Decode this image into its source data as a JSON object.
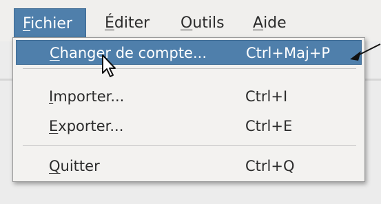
{
  "menubar": {
    "file": {
      "pre": "",
      "key": "F",
      "post": "ichier"
    },
    "edit": {
      "pre": "",
      "key": "É",
      "post": "diter"
    },
    "tools": {
      "pre": "",
      "key": "O",
      "post": "utils"
    },
    "help": {
      "pre": "",
      "key": "A",
      "post": "ide"
    }
  },
  "file_menu": {
    "items": [
      {
        "pre": "",
        "key": "C",
        "post": "hanger de compte...",
        "shortcut": "Ctrl+Maj+P"
      },
      {
        "pre": "",
        "key": "I",
        "post": "mporter...",
        "shortcut": "Ctrl+I"
      },
      {
        "pre": "",
        "key": "E",
        "post": "xporter...",
        "shortcut": "Ctrl+E"
      },
      {
        "pre": "",
        "key": "Q",
        "post": "uitter",
        "shortcut": "Ctrl+Q"
      }
    ]
  },
  "colors": {
    "highlight": "#4f7fab",
    "menu_bg": "#f3f2f0",
    "text": "#2b2b2b"
  },
  "icons": [
    "mouse-pointer-icon",
    "annotation-arrow-icon"
  ]
}
